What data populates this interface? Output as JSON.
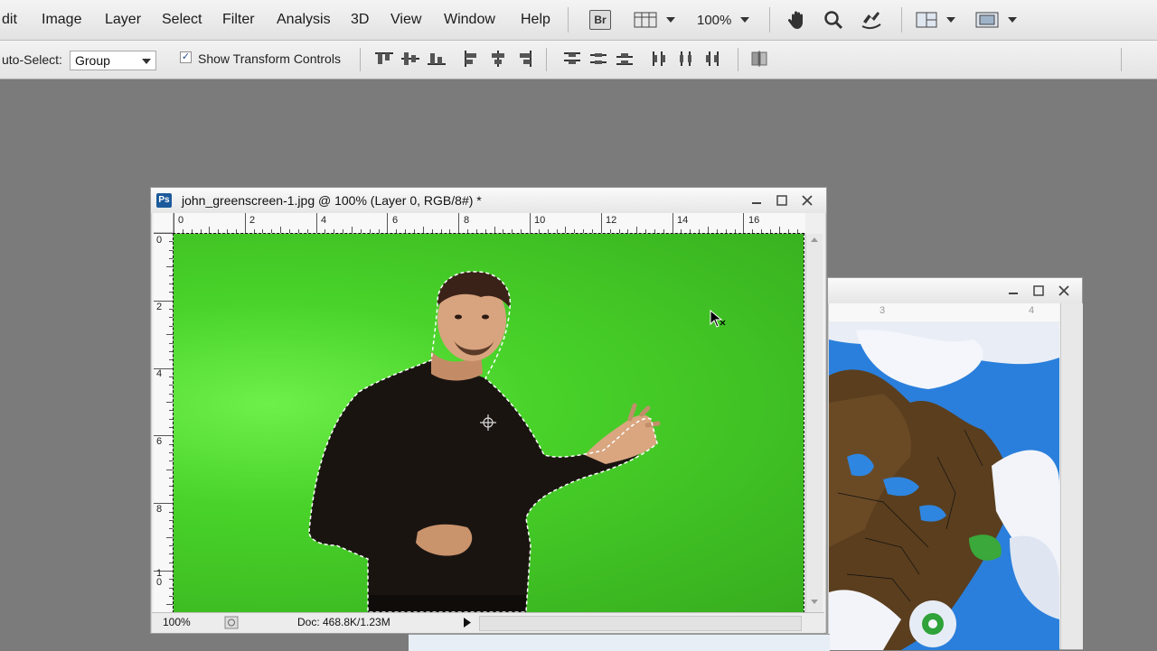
{
  "menubar": {
    "items": [
      "dit",
      "Image",
      "Layer",
      "Select",
      "Filter",
      "Analysis",
      "3D",
      "View",
      "Window",
      "Help"
    ],
    "bridge_label": "Br",
    "zoom": "100%"
  },
  "options": {
    "auto_select_label": "uto-Select:",
    "auto_select_value": "Group",
    "show_transform_checked": true,
    "show_transform_label": "Show Transform Controls"
  },
  "doc_main": {
    "ps_badge": "Ps",
    "title": "john_greenscreen-1.jpg @ 100% (Layer 0, RGB/8#) *",
    "ruler_top": [
      "0",
      "2",
      "4",
      "6",
      "8",
      "10",
      "12",
      "14",
      "16"
    ],
    "ruler_left": [
      "0",
      "2",
      "4",
      "6",
      "8",
      "1\n0"
    ],
    "status_zoom": "100%",
    "status_doc": "Doc: 468.8K/1.23M"
  },
  "doc_weather": {
    "ruler_top": [
      "3",
      "4"
    ]
  },
  "colors": {
    "workspace": "#7b7b7b",
    "greenscreen": "#3dbb22",
    "ps_blue": "#1c5a9c"
  }
}
